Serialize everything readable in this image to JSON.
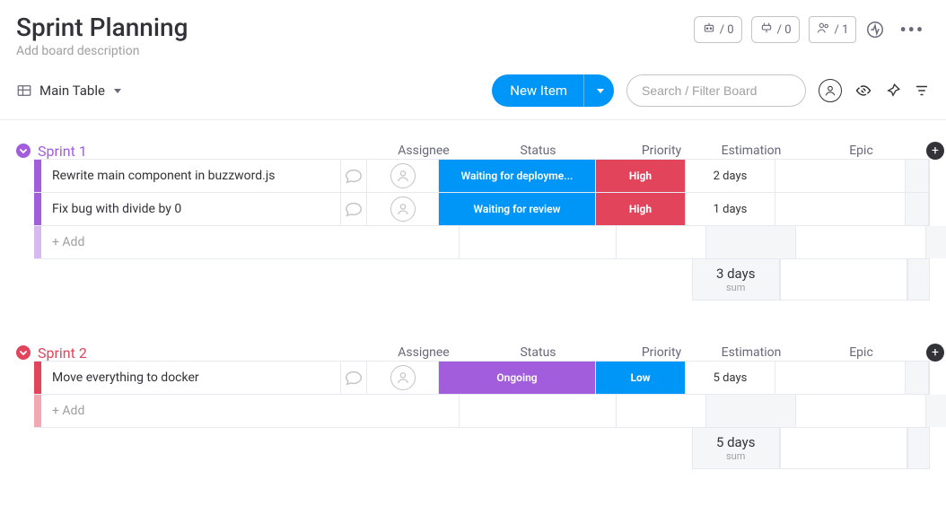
{
  "header": {
    "title": "Sprint Planning",
    "description_placeholder": "Add board description",
    "stat_automation": "/ 0",
    "stat_integration": "/ 0",
    "stat_members": "/ 1"
  },
  "toolbar": {
    "view_label": "Main Table",
    "new_item_label": "New Item",
    "search_placeholder": "Search / Filter Board"
  },
  "columns": {
    "assignee": "Assignee",
    "status": "Status",
    "priority": "Priority",
    "estimation": "Estimation",
    "epic": "Epic"
  },
  "colors": {
    "sprint1": {
      "main": "#a25ddc",
      "light": "#d7b9f0",
      "title": "#a25ddc"
    },
    "sprint2": {
      "main": "#e2445c",
      "light": "#f2a8b3",
      "title": "#e2445c"
    },
    "status_waiting_deploy": "#0096f8",
    "status_waiting_review": "#0096f8",
    "status_ongoing": "#a25ddc",
    "priority_high": "#e2445c",
    "priority_low": "#0096f8"
  },
  "groups": [
    {
      "id": "sprint1",
      "title": "Sprint 1",
      "items": [
        {
          "name": "Rewrite main component in buzzword.js",
          "status": "Waiting for deployme...",
          "status_color": "status_waiting_deploy",
          "priority": "High",
          "priority_color": "priority_high",
          "estimation": "2 days",
          "epic": ""
        },
        {
          "name": "Fix bug with divide by 0",
          "status": "Waiting for review",
          "status_color": "status_waiting_review",
          "priority": "High",
          "priority_color": "priority_high",
          "estimation": "1 days",
          "epic": ""
        }
      ],
      "add_label": "+ Add",
      "summary": {
        "estimation_value": "3 days",
        "estimation_label": "sum"
      }
    },
    {
      "id": "sprint2",
      "title": "Sprint 2",
      "items": [
        {
          "name": "Move everything to docker",
          "status": "Ongoing",
          "status_color": "status_ongoing",
          "priority": "Low",
          "priority_color": "priority_low",
          "estimation": "5 days",
          "epic": ""
        }
      ],
      "add_label": "+ Add",
      "summary": {
        "estimation_value": "5 days",
        "estimation_label": "sum"
      }
    }
  ]
}
